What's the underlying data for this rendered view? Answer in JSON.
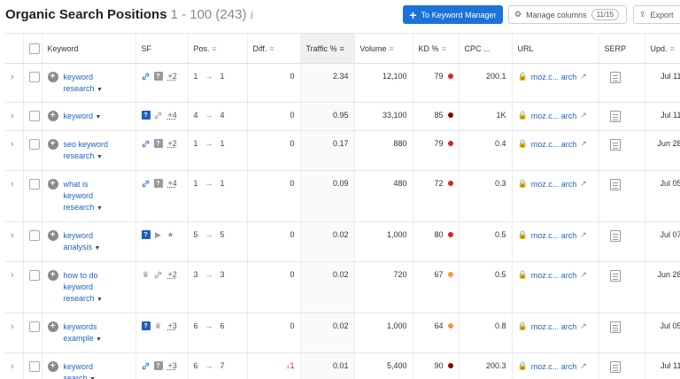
{
  "header": {
    "title": "Organic Search Positions",
    "range": "1 - 100 (243)",
    "info_icon": "i",
    "keyword_manager_label": "To Keyword Manager",
    "manage_columns_label": "Manage columns",
    "columns_badge": "11/15",
    "export_label": "Export"
  },
  "columns": {
    "keyword": "Keyword",
    "sf": "SF",
    "pos": "Pos.",
    "diff": "Diff.",
    "traffic": "Traffic %",
    "volume": "Volume",
    "kd": "KD %",
    "cpc": "CPC ...",
    "url": "URL",
    "serp": "SERP",
    "upd": "Upd."
  },
  "rows": [
    {
      "keyword": "keyword research",
      "sf_icons": [
        "link-icon",
        "review-icon"
      ],
      "sf_more": "+2",
      "pos_from": "1",
      "pos_to": "1",
      "diff": "0",
      "traffic": "2.34",
      "volume": "12,100",
      "kd": "79",
      "kd_color": "#e02020",
      "cpc": "200.1",
      "url": "moz.c... arch",
      "upd": "Jul 11"
    },
    {
      "keyword": "keyword",
      "sf_icons": [
        "review-icon",
        "link-icon"
      ],
      "sf_more": "+4",
      "pos_from": "4",
      "pos_to": "4",
      "diff": "0",
      "traffic": "0.95",
      "volume": "33,100",
      "kd": "85",
      "kd_color": "#8b0000",
      "cpc": "1K",
      "url": "moz.c... arch",
      "upd": "Jul 11"
    },
    {
      "keyword": "seo keyword research",
      "sf_icons": [
        "link-icon",
        "review-icon"
      ],
      "sf_more": "+2",
      "pos_from": "1",
      "pos_to": "1",
      "diff": "0",
      "traffic": "0.17",
      "volume": "880",
      "kd": "79",
      "kd_color": "#e02020",
      "cpc": "0.4",
      "url": "moz.c... arch",
      "upd": "Jun 28"
    },
    {
      "keyword": "what is keyword research",
      "sf_icons": [
        "link-icon",
        "review-icon"
      ],
      "sf_more": "+4",
      "pos_from": "1",
      "pos_to": "1",
      "diff": "0",
      "traffic": "0.09",
      "volume": "480",
      "kd": "72",
      "kd_color": "#e02020",
      "cpc": "0.3",
      "url": "moz.c... arch",
      "upd": "Jul 05"
    },
    {
      "keyword": "keyword analysis",
      "sf_icons": [
        "review-icon",
        "video-icon",
        "star-icon"
      ],
      "sf_more": "",
      "pos_from": "5",
      "pos_to": "5",
      "diff": "0",
      "traffic": "0.02",
      "volume": "1,000",
      "kd": "80",
      "kd_color": "#e02020",
      "cpc": "0.5",
      "url": "moz.c... arch",
      "upd": "Jul 07"
    },
    {
      "keyword": "how to do keyword research",
      "sf_icons": [
        "crown-icon",
        "link-icon"
      ],
      "sf_more": "+2",
      "pos_from": "3",
      "pos_to": "3",
      "diff": "0",
      "traffic": "0.02",
      "volume": "720",
      "kd": "67",
      "kd_color": "#f29a2e",
      "cpc": "0.5",
      "url": "moz.c... arch",
      "upd": "Jun 28"
    },
    {
      "keyword": "keywords example",
      "sf_icons": [
        "review-icon",
        "crown-icon"
      ],
      "sf_more": "+3",
      "pos_from": "6",
      "pos_to": "6",
      "diff": "0",
      "traffic": "0.02",
      "volume": "1,000",
      "kd": "64",
      "kd_color": "#f29a2e",
      "cpc": "0.8",
      "url": "moz.c... arch",
      "upd": "Jul 05"
    },
    {
      "keyword": "keyword search",
      "sf_icons": [
        "link-icon",
        "review-icon"
      ],
      "sf_more": "+3",
      "pos_from": "6",
      "pos_to": "7",
      "diff": "1",
      "diff_dir": "down",
      "traffic": "0.01",
      "volume": "5,400",
      "kd": "90",
      "kd_color": "#8b0000",
      "cpc": "200.3",
      "url": "moz.c... arch",
      "upd": "Jul 11"
    }
  ]
}
